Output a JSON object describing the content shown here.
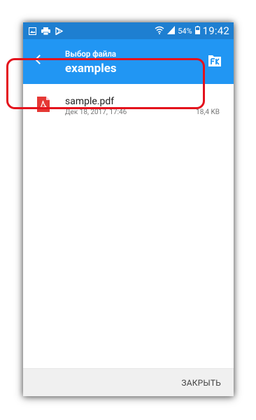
{
  "status_bar": {
    "battery_percent": "54%",
    "time": "19:42",
    "icons": [
      "gallery-icon",
      "print-icon",
      "play-store-icon",
      "wifi-icon",
      "signal-icon",
      "battery-icon"
    ]
  },
  "app_bar": {
    "subtitle": "Выбор файла",
    "title": "examples",
    "color": "#2196f3",
    "status_color": "#1e7fd1"
  },
  "files": [
    {
      "name": "sample.pdf",
      "date": "Дек 18, 2017, 17:46",
      "size": "18,4 KB",
      "icon": "pdf-icon"
    }
  ],
  "footer": {
    "close_label": "ЗАКРЫТЬ"
  },
  "highlight_color": "#e4121c"
}
